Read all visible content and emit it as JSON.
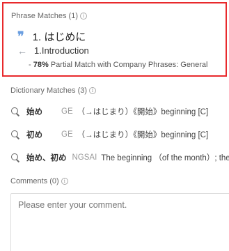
{
  "phrase": {
    "header": "Phrase Matches (1)",
    "source": "1. はじめに",
    "target": "1.Introduction",
    "match_percent": "78%",
    "match_note": " Partial Match with Company Phrases: General",
    "prefix": "- "
  },
  "dictionary": {
    "header": "Dictionary Matches (3)",
    "entries": [
      {
        "term": "始め",
        "source": "GE",
        "definition": "（→はじまり）《開始》beginning [C]"
      },
      {
        "term": "初め",
        "source": "GE",
        "definition": "（→はじまり）《開始》beginning [C]"
      },
      {
        "term": "始め、初め",
        "source": "NGSAI",
        "definition": "The beginning （of the month）; the"
      }
    ]
  },
  "comments": {
    "header": "Comments (0)",
    "placeholder": "Please enter your comment."
  },
  "colors": {
    "highlight_border": "#e8292c",
    "quote_icon": "#6a9ee0"
  }
}
